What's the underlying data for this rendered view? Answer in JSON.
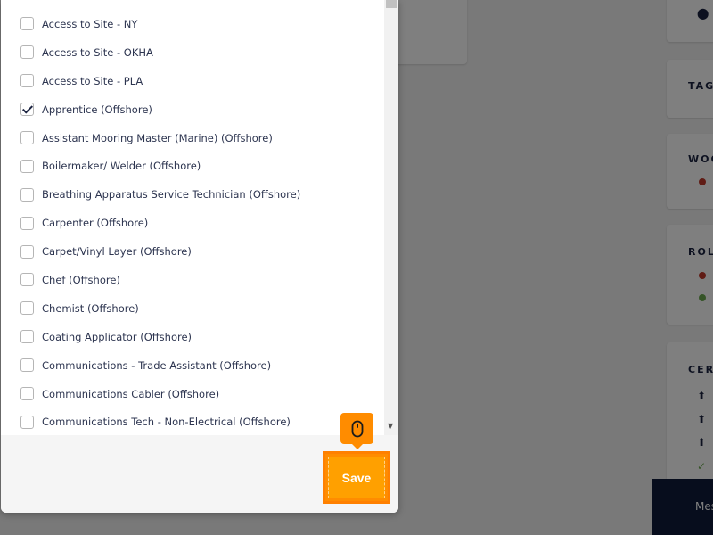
{
  "checklist": {
    "items": [
      {
        "label": "Access to Site - NY",
        "checked": false
      },
      {
        "label": "Access to Site - OKHA",
        "checked": false
      },
      {
        "label": "Access to Site - PLA",
        "checked": false
      },
      {
        "label": "Apprentice (Offshore)",
        "checked": true
      },
      {
        "label": "Assistant Mooring Master (Marine) (Offshore)",
        "checked": false
      },
      {
        "label": "Boilermaker/ Welder (Offshore)",
        "checked": false
      },
      {
        "label": "Breathing Apparatus Service Technician (Offshore)",
        "checked": false
      },
      {
        "label": "Carpenter (Offshore)",
        "checked": false
      },
      {
        "label": "Carpet/Vinyl Layer (Offshore)",
        "checked": false
      },
      {
        "label": "Chef (Offshore)",
        "checked": false
      },
      {
        "label": "Chemist (Offshore)",
        "checked": false
      },
      {
        "label": "Coating Applicator (Offshore)",
        "checked": false
      },
      {
        "label": "Communications - Trade Assistant (Offshore)",
        "checked": false
      },
      {
        "label": "Communications Cabler (Offshore)",
        "checked": false
      },
      {
        "label": "Communications Tech - Non-Electrical (Offshore)",
        "checked": false
      }
    ]
  },
  "modal": {
    "save_label": "Save"
  },
  "background": {
    "card_titles": [
      "TAG",
      "WOO",
      "ROL",
      "CER"
    ],
    "bottom_bar_label": "Mes"
  },
  "colors": {
    "save": "#ffa000",
    "highlight": "#ff8c00",
    "navy": "#1b2340"
  },
  "icons": {
    "tooltip": "mouse-icon",
    "scroll": "chevron-down-icon",
    "upload": "upload-icon",
    "check": "check-icon",
    "pin": "location-pin-icon"
  }
}
